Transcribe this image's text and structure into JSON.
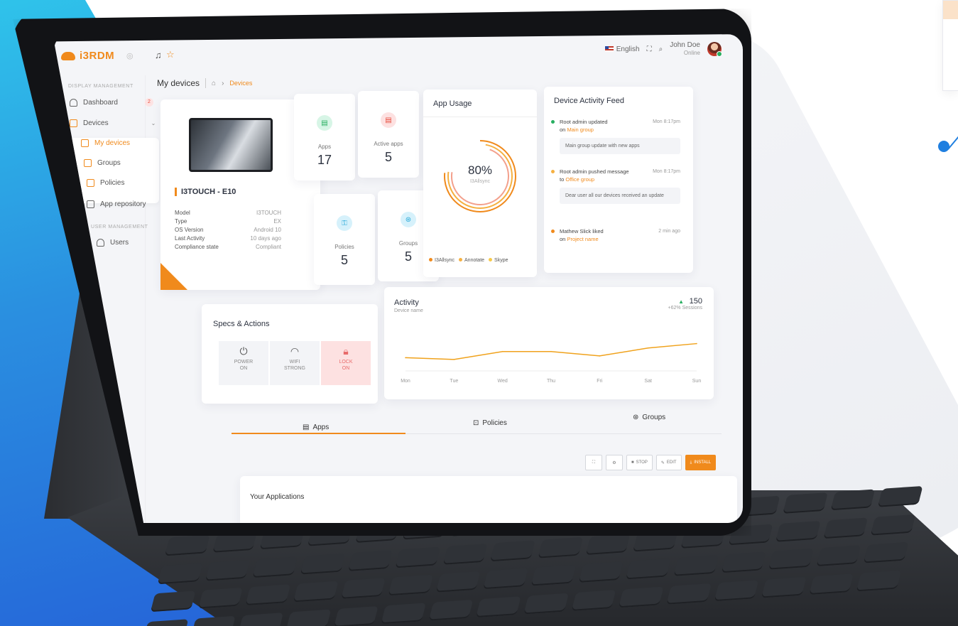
{
  "app": {
    "brand": "i3RDM"
  },
  "topbar": {
    "language": "English",
    "user_name": "John Doe",
    "user_status": "Online"
  },
  "sidebar": {
    "section_display": "DISPLAY MANAGEMENT",
    "section_user": "USER MANAGEMENT",
    "items": [
      {
        "label": "Dashboard",
        "badge": "2"
      },
      {
        "label": "Devices"
      },
      {
        "label": "My devices"
      },
      {
        "label": "Groups"
      },
      {
        "label": "Policies"
      },
      {
        "label": "App repository"
      },
      {
        "label": "Users"
      }
    ]
  },
  "breadcrumb": {
    "title": "My devices",
    "crumb": "Devices"
  },
  "device": {
    "name": "I3TOUCH - E10",
    "specs": [
      {
        "key": "Model",
        "value": "I3TOUCH"
      },
      {
        "key": "Type",
        "value": "EX"
      },
      {
        "key": "OS Version",
        "value": "Android 10"
      },
      {
        "key": "Last Activity",
        "value": "10 days ago"
      },
      {
        "key": "Compliance state",
        "value": "Compliant"
      }
    ]
  },
  "stats": [
    {
      "label": "Apps",
      "value": "17"
    },
    {
      "label": "Active apps",
      "value": "5"
    },
    {
      "label": "Policies",
      "value": "5"
    },
    {
      "label": "Groups",
      "value": "5"
    }
  ],
  "app_usage": {
    "title": "App Usage",
    "percent": "80%",
    "sub": "I3Allsync",
    "legend": [
      "I3Allsync",
      "Annotate",
      "Skype"
    ],
    "colors": {
      "i3allsync": "#f08a1c",
      "annotate": "#f5b041",
      "skype": "#f7c948"
    }
  },
  "feed": {
    "title": "Device Activity Feed",
    "items": [
      {
        "line1": "Root admin updated",
        "prefix": "on",
        "link": "Main group",
        "time": "Mon 8:17pm",
        "note": "Main group update with new apps"
      },
      {
        "line1": "Root admin pushed message",
        "prefix": "to",
        "link": "Office group",
        "time": "Mon 8:17pm",
        "note": "Dear user all our devices received an update"
      },
      {
        "line1": "Mathew Slick liked",
        "prefix": "on",
        "link": "Project name",
        "time": "2 min ago",
        "note": ""
      }
    ]
  },
  "specs_actions": {
    "title": "Specs & Actions",
    "buttons": [
      {
        "line1": "POWER",
        "line2": "ON"
      },
      {
        "line1": "WIFI",
        "line2": "STRONG"
      },
      {
        "line1": "LOCK",
        "line2": "ON"
      }
    ]
  },
  "activity": {
    "title": "Activity",
    "subtitle": "Device name",
    "value": "150",
    "change": "+62%",
    "unit": "Sessions"
  },
  "chart_data": {
    "type": "line",
    "categories": [
      "Mon",
      "Tue",
      "Wed",
      "Thu",
      "Fri",
      "Sat",
      "Sun"
    ],
    "series": [
      {
        "values": [
          3,
          2.6,
          4.4,
          4.4,
          3.4,
          5.2,
          6.2
        ]
      }
    ],
    "ylim": [
      0,
      10
    ],
    "grid": false
  },
  "tabs": [
    "Apps",
    "Policies",
    "Groups"
  ],
  "toolbar": {
    "stop": "STOP",
    "edit": "EDIT",
    "install": "INSTALL"
  },
  "apps_panel": {
    "title": "Your Applications"
  }
}
